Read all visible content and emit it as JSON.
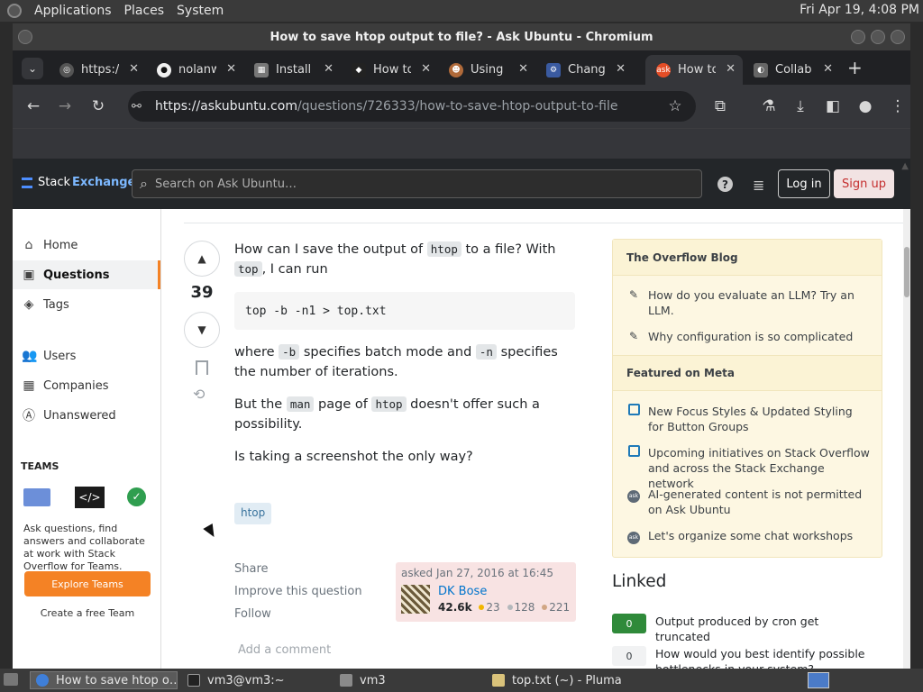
{
  "top_panel": {
    "menus": [
      "Applications",
      "Places",
      "System"
    ],
    "clock": "Fri Apr 19,  4:08 PM"
  },
  "window": {
    "title": "How to save htop output to file? - Ask Ubuntu - Chromium"
  },
  "tabs": [
    {
      "label": "https://",
      "icon": "globe-icon",
      "active": false
    },
    {
      "label": "nolanw",
      "icon": "github-icon",
      "active": false
    },
    {
      "label": "Install",
      "icon": "install-icon",
      "active": false
    },
    {
      "label": "How to",
      "icon": "site-icon",
      "active": false
    },
    {
      "label": "Using",
      "icon": "avatar-icon",
      "active": false
    },
    {
      "label": "Change",
      "icon": "settings-icon",
      "active": false
    },
    {
      "label": "How to",
      "icon": "askubuntu-icon",
      "active": true
    },
    {
      "label": "Collab",
      "icon": "collab-icon",
      "active": false
    }
  ],
  "toolbar": {
    "url_host": "https://askubuntu.com",
    "url_path": "/questions/726333/how-to-save-htop-output-to-file"
  },
  "se_header": {
    "logo_text": "Stack",
    "logo_bold": "Exchange",
    "search_placeholder": "Search on Ask Ubuntu…",
    "login_label": "Log in",
    "signup_label": "Sign up"
  },
  "leftnav": {
    "items": [
      {
        "label": "Home",
        "icon": "home-icon"
      },
      {
        "label": "Questions",
        "icon": "questions-icon"
      },
      {
        "label": "Tags",
        "icon": "tag-icon"
      },
      {
        "label": "Users",
        "icon": "users-icon"
      },
      {
        "label": "Companies",
        "icon": "companies-icon"
      },
      {
        "label": "Unanswered",
        "icon": "unanswered-icon"
      }
    ],
    "teams_heading": "TEAMS",
    "teams_text": "Ask questions, find answers and collaborate at work with Stack Overflow for Teams.",
    "explore_label": "Explore Teams",
    "free_team_label": "Create a free Team"
  },
  "question": {
    "votes": "39",
    "p1_a": "How can I save the output of ",
    "p1_code1": "htop",
    "p1_b": " to a file? With ",
    "p1_code2": "top",
    "p1_c": ", I can run",
    "codeblock": "top -b -n1 > top.txt",
    "p2_a": "where ",
    "p2_code1": "-b",
    "p2_b": " specifies batch mode and ",
    "p2_code2": "-n",
    "p2_c": " specifies the number of iterations.",
    "p3_a": "But the ",
    "p3_code1": "man",
    "p3_b": " page of ",
    "p3_code2": "htop",
    "p3_c": " doesn't offer such a possibility.",
    "p4": "Is taking a screenshot the only way?",
    "tag": "htop",
    "menu": [
      "Share",
      "Improve this question",
      "Follow"
    ],
    "asked": "asked Jan 27, 2016 at 16:45",
    "owner_name": "DK Bose",
    "owner_rep": "42.6k",
    "gold": "23",
    "silver": "128",
    "bronze": "221",
    "add_comment": "Add a comment"
  },
  "sidebar": {
    "blog_heading": "The Overflow Blog",
    "blog_items": [
      "How do you evaluate an LLM? Try an LLM.",
      "Why configuration is so complicated"
    ],
    "meta_heading": "Featured on Meta",
    "meta_items": [
      "New Focus Styles & Updated Styling for Button Groups",
      "Upcoming initiatives on Stack Overflow and across the Stack Exchange network",
      "AI-generated content is not permitted on Ask Ubuntu",
      "Let's organize some chat workshops"
    ],
    "linked_heading": "Linked",
    "linked": [
      {
        "score": "0",
        "title": "Output produced by cron get truncated",
        "answered": true
      },
      {
        "score": "0",
        "title": "How would you best identify possible bottlenecks in your system?",
        "answered": false
      }
    ]
  },
  "taskbar": {
    "items": [
      "How to save htop o…",
      "vm3@vm3:~",
      "vm3",
      "top.txt (~) - Pluma"
    ]
  },
  "colors": {
    "accent_orange": "#f48225",
    "link_blue": "#0074cc",
    "answered_green": "#2f8a3a"
  }
}
